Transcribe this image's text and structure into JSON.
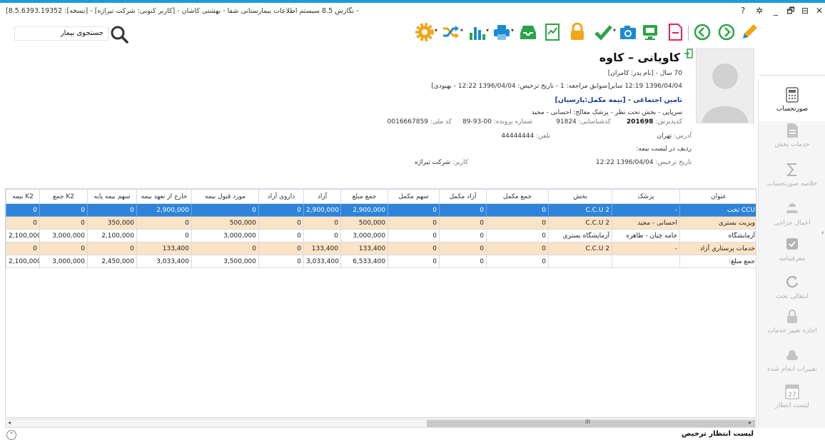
{
  "window": {
    "title": "[8.5.6393.19352 :[نسخه] - نگارش 8.5 سیستم اطلاعات بیمارستانی شفا - بهشتی کاشان - [کاربر کنونی: شرکت تیراژه] -",
    "controls": [
      "?",
      "✲",
      "_",
      "🗗",
      "⊟",
      "✕"
    ]
  },
  "search": {
    "label": "جستجوی بیمار"
  },
  "patient": {
    "name": "کاویانی – کاوه",
    "age_line": "70 سال - [نام پدر: کامران]",
    "visit_line": "1396/04/04 12:19   سایر[سوابق مراجعه: 1 - تاریخ ترخیص: 1396/04/04 12:22 - بهبودی]",
    "insurance": "تامین اجتماعی - [بیمه مکمل:پارسیان]",
    "ward_line": "سرپایی - بخش تحت نظر - پزشک معالج: احسانی - مجید",
    "admission_label": "کدپذیرش:",
    "admission_value": "201698",
    "identity_label": "کدشناسایی:",
    "identity_value": "91824",
    "file_label": "شماره پرونده:",
    "file_value": "00-93-89",
    "national_label": "کد ملی:",
    "national_value": "0016667859",
    "address_label": "آدرس:",
    "address_value": "تهران",
    "phone_label": "تلفن:",
    "phone_value": "44444444",
    "insurance_list_label": "ردیف در لیست بیمه:",
    "discharge_label": "تاریخ ترخیص:",
    "discharge_value": "1396/04/04 12:22",
    "user_label": "کاربر:",
    "user_value": "شرکت تیراژه"
  },
  "sidebar": {
    "items": [
      {
        "label": "صورتحساب",
        "icon": "calculator-icon"
      },
      {
        "label": "خدمات بخش",
        "icon": "document-icon"
      },
      {
        "label": "خلاصه صورتحساب",
        "icon": "sigma-icon"
      },
      {
        "label": "اعمال جراحی",
        "icon": "surgery-icon"
      },
      {
        "label": "معرفینامه",
        "icon": "check-badge-icon"
      },
      {
        "label": "انتقالی تخت",
        "icon": "refresh-icon"
      },
      {
        "label": "اجازه تغییر خدمات",
        "icon": "lock-icon"
      },
      {
        "label": "تغییرات انجام شده",
        "icon": "cloud-icon"
      },
      {
        "label": "لیست انتظار",
        "icon": "calendar-icon"
      }
    ],
    "calendar_number": "27"
  },
  "table": {
    "headers": [
      "عنوان",
      "پزشک",
      "بخش",
      "جمع مکمل",
      "آزاد مکمل",
      "سهم مکمل",
      "جمع مبلغ",
      "آزاد",
      "داروی آزاد",
      "مورد قبول بیمه",
      "خارج از تعهد بیمه",
      "سهم بیمه پایه",
      "جمع K2",
      "بیمه K2"
    ],
    "rows": [
      {
        "cells": [
          "CCU تخت",
          "-",
          "C.C.U 2",
          "0",
          "0",
          "0",
          "2,900,000",
          "2,900,000",
          "0",
          "0",
          "2,900,000",
          "0",
          "0",
          "0"
        ]
      },
      {
        "cells": [
          "ویزیت بستری",
          "احسانی - مجید",
          "C.C.U 2",
          "0",
          "0",
          "0",
          "500,000",
          "0",
          "0",
          "500,000",
          "0",
          "350,000",
          "0",
          "0"
        ]
      },
      {
        "cells": [
          "آزمایشگاه",
          "خامه چیان - طاهره",
          "آزمایشگاه بستری",
          "0",
          "0",
          "0",
          "3,000,000",
          "0",
          "0",
          "3,000,000",
          "0",
          "2,100,000",
          "3,000,000",
          "2,100,000"
        ]
      },
      {
        "cells": [
          "خدمات پرستاری آزاد",
          "-",
          "C.C.U 2",
          "0",
          "0",
          "0",
          "133,400",
          "133,400",
          "0",
          "0",
          "133,400",
          "0",
          "0",
          "0"
        ]
      },
      {
        "cells": [
          "جمع مبلغ:",
          "",
          "",
          "0",
          "0",
          "0",
          "6,533,400",
          "3,033,400",
          "0",
          "3,500,000",
          "3,033,400",
          "2,450,000",
          "3,000,000",
          "2,100,000"
        ]
      }
    ]
  },
  "scroll": {
    "mid": "III"
  },
  "footer": {
    "title": "لیست انتظار ترخیص"
  }
}
